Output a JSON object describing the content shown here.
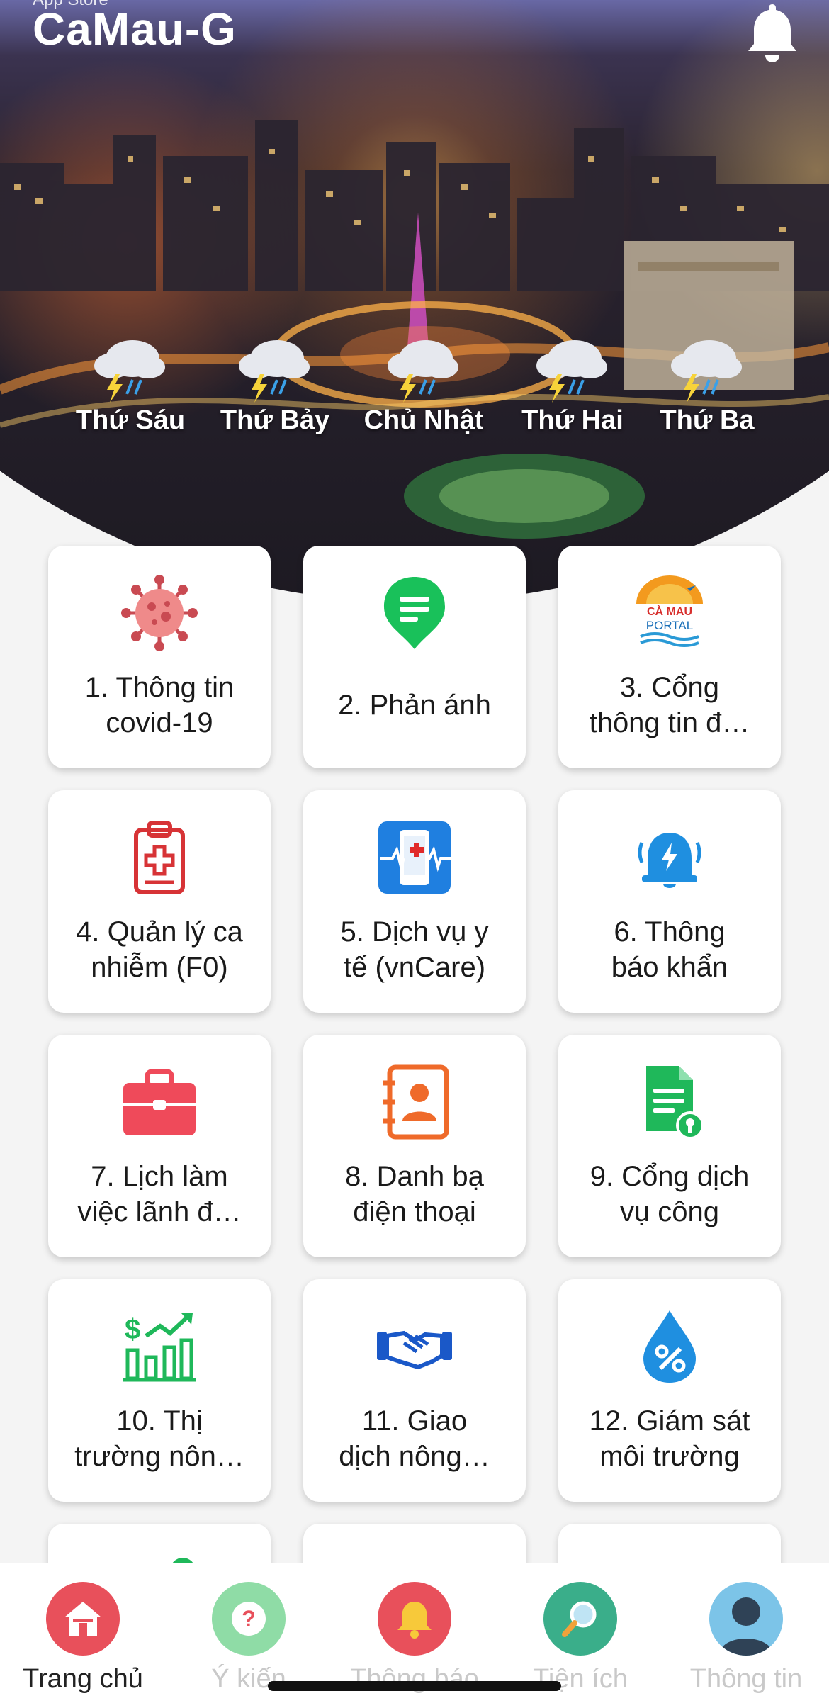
{
  "header": {
    "small_text": "App Store",
    "title": "CaMau-G"
  },
  "weather": [
    {
      "day": "Thứ Sáu",
      "icon": "storm-cloud-icon"
    },
    {
      "day": "Thứ Bảy",
      "icon": "storm-cloud-icon"
    },
    {
      "day": "Chủ Nhật",
      "icon": "storm-cloud-icon"
    },
    {
      "day": "Thứ Hai",
      "icon": "storm-cloud-icon"
    },
    {
      "day": "Thứ Ba",
      "icon": "storm-cloud-icon"
    }
  ],
  "features": [
    {
      "line1": "1. Thông tin",
      "line2": "covid-19",
      "icon": "virus-icon"
    },
    {
      "line1": "2. Phản ánh",
      "line2": "",
      "icon": "feedback-pin-icon"
    },
    {
      "line1": "3. Cổng",
      "line2": "thông tin đ…",
      "icon": "camau-portal-logo",
      "logo_text_1": "CÀ MAU",
      "logo_text_2": "PORTAL"
    },
    {
      "line1": "4. Quản lý ca",
      "line2": "nhiễm (F0)",
      "icon": "medical-clipboard-icon"
    },
    {
      "line1": "5. Dịch vụ y",
      "line2": "tế (vnCare)",
      "icon": "phone-health-icon"
    },
    {
      "line1": "6. Thông",
      "line2": "báo khẩn",
      "icon": "alarm-bell-icon"
    },
    {
      "line1": "7. Lịch làm",
      "line2": "việc lãnh đ…",
      "icon": "briefcase-icon"
    },
    {
      "line1": "8. Danh bạ",
      "line2": "điện thoại",
      "icon": "contact-book-icon"
    },
    {
      "line1": "9. Cổng dịch",
      "line2": "vụ công",
      "icon": "document-key-icon"
    },
    {
      "line1": "10. Thị",
      "line2": "trường nôn…",
      "icon": "market-chart-icon"
    },
    {
      "line1": "11. Giao",
      "line2": "dịch nông…",
      "icon": "handshake-icon"
    },
    {
      "line1": "12. Giám sát",
      "line2": "môi trường",
      "icon": "water-drop-icon"
    }
  ],
  "bottom_nav": [
    {
      "label": "Trang chủ",
      "icon": "home-icon",
      "active": true
    },
    {
      "label": "Ý kiến",
      "icon": "question-icon",
      "active": false
    },
    {
      "label": "Thông báo",
      "icon": "bell-icon",
      "active": false
    },
    {
      "label": "Tiện ích",
      "icon": "search-icon",
      "active": false
    },
    {
      "label": "Thông tin",
      "icon": "user-icon",
      "active": false
    }
  ],
  "colors": {
    "home": "#e8505b",
    "feedback": "#8fdca6",
    "notify": "#e8505b",
    "utility": "#3aae8a",
    "profile": "#7cc4e8"
  }
}
